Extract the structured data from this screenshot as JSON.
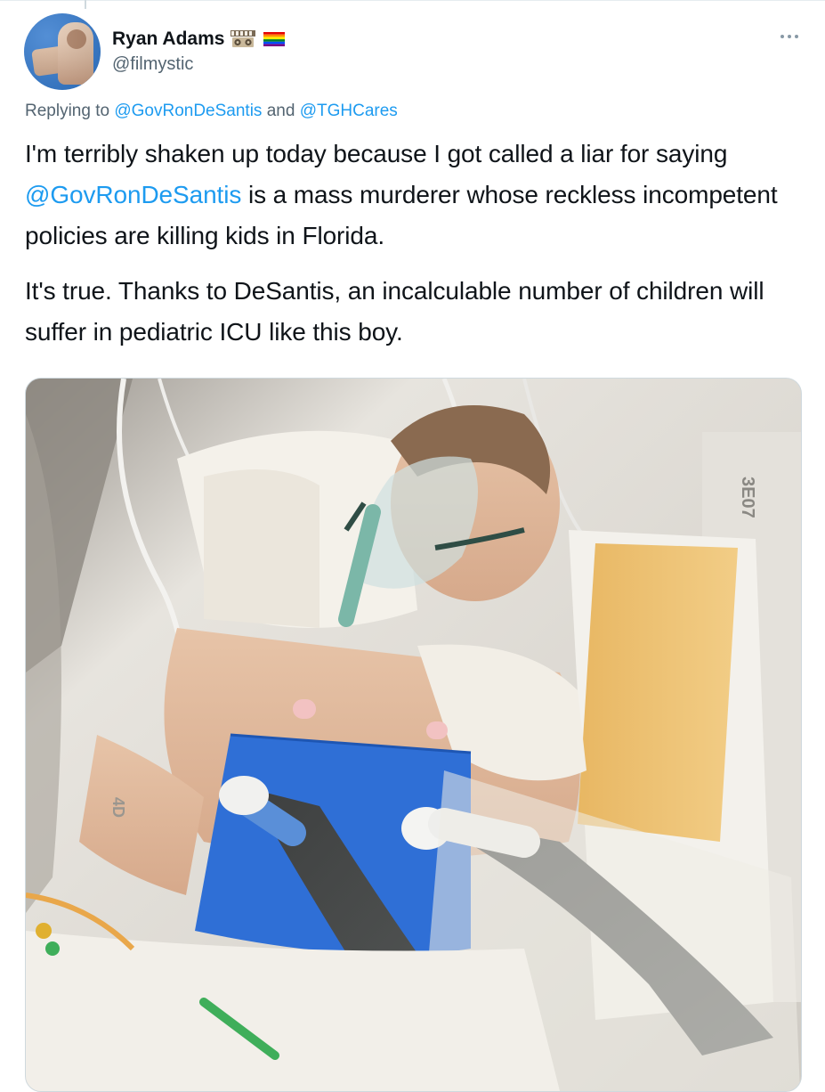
{
  "author": {
    "display_name": "Ryan Adams",
    "handle": "@filmystic",
    "name_emoji": [
      "film-projector-icon",
      "rainbow-flag-icon"
    ]
  },
  "reply_context": {
    "prefix": "Replying to",
    "mention_1": "@GovRonDeSantis",
    "joiner": "and",
    "mention_2": "@TGHCares"
  },
  "tweet": {
    "p1_before": "I'm terribly shaken up today because I got called a liar for saying ",
    "p1_mention": "@GovRonDeSantis",
    "p1_after": " is a mass murderer whose reckless incompetent policies are killing kids in Florida.",
    "p2": "It's true. Thanks to DeSantis, an incalculable number of children will suffer in pediatric ICU like this boy."
  },
  "media": {
    "kind": "photo",
    "bed_marking_1": "3E07",
    "bed_marking_2": "4D"
  },
  "colors": {
    "link": "#1d9bf0",
    "secondary_text": "#536471",
    "primary_text": "#0f1419"
  }
}
